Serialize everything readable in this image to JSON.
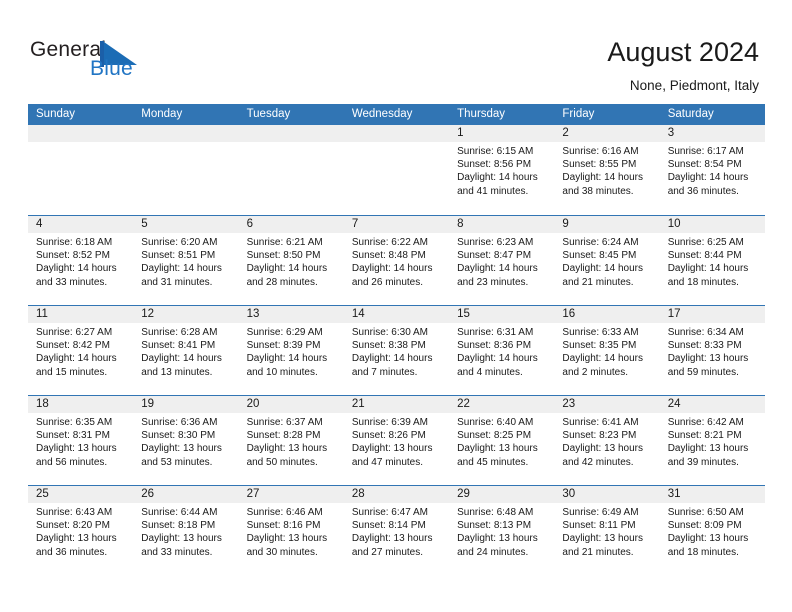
{
  "brand": {
    "name_part1": "General",
    "name_part2": "Blue",
    "logo_icon": "blue-flag-logo"
  },
  "header": {
    "title": "August 2024",
    "subtitle": "None, Piedmont, Italy"
  },
  "colors": {
    "header_blue": "#3175b4",
    "brand_blue": "#2175c4",
    "day_band_gray": "#efefef",
    "text": "#1a1a1a"
  },
  "weekdays": [
    "Sunday",
    "Monday",
    "Tuesday",
    "Wednesday",
    "Thursday",
    "Friday",
    "Saturday"
  ],
  "weeks": [
    [
      {
        "day": "",
        "empty": true
      },
      {
        "day": "",
        "empty": true
      },
      {
        "day": "",
        "empty": true
      },
      {
        "day": "",
        "empty": true
      },
      {
        "day": "1",
        "sunrise": "Sunrise: 6:15 AM",
        "sunset": "Sunset: 8:56 PM",
        "daylight": "Daylight: 14 hours and 41 minutes."
      },
      {
        "day": "2",
        "sunrise": "Sunrise: 6:16 AM",
        "sunset": "Sunset: 8:55 PM",
        "daylight": "Daylight: 14 hours and 38 minutes."
      },
      {
        "day": "3",
        "sunrise": "Sunrise: 6:17 AM",
        "sunset": "Sunset: 8:54 PM",
        "daylight": "Daylight: 14 hours and 36 minutes."
      }
    ],
    [
      {
        "day": "4",
        "sunrise": "Sunrise: 6:18 AM",
        "sunset": "Sunset: 8:52 PM",
        "daylight": "Daylight: 14 hours and 33 minutes."
      },
      {
        "day": "5",
        "sunrise": "Sunrise: 6:20 AM",
        "sunset": "Sunset: 8:51 PM",
        "daylight": "Daylight: 14 hours and 31 minutes."
      },
      {
        "day": "6",
        "sunrise": "Sunrise: 6:21 AM",
        "sunset": "Sunset: 8:50 PM",
        "daylight": "Daylight: 14 hours and 28 minutes."
      },
      {
        "day": "7",
        "sunrise": "Sunrise: 6:22 AM",
        "sunset": "Sunset: 8:48 PM",
        "daylight": "Daylight: 14 hours and 26 minutes."
      },
      {
        "day": "8",
        "sunrise": "Sunrise: 6:23 AM",
        "sunset": "Sunset: 8:47 PM",
        "daylight": "Daylight: 14 hours and 23 minutes."
      },
      {
        "day": "9",
        "sunrise": "Sunrise: 6:24 AM",
        "sunset": "Sunset: 8:45 PM",
        "daylight": "Daylight: 14 hours and 21 minutes."
      },
      {
        "day": "10",
        "sunrise": "Sunrise: 6:25 AM",
        "sunset": "Sunset: 8:44 PM",
        "daylight": "Daylight: 14 hours and 18 minutes."
      }
    ],
    [
      {
        "day": "11",
        "sunrise": "Sunrise: 6:27 AM",
        "sunset": "Sunset: 8:42 PM",
        "daylight": "Daylight: 14 hours and 15 minutes."
      },
      {
        "day": "12",
        "sunrise": "Sunrise: 6:28 AM",
        "sunset": "Sunset: 8:41 PM",
        "daylight": "Daylight: 14 hours and 13 minutes."
      },
      {
        "day": "13",
        "sunrise": "Sunrise: 6:29 AM",
        "sunset": "Sunset: 8:39 PM",
        "daylight": "Daylight: 14 hours and 10 minutes."
      },
      {
        "day": "14",
        "sunrise": "Sunrise: 6:30 AM",
        "sunset": "Sunset: 8:38 PM",
        "daylight": "Daylight: 14 hours and 7 minutes."
      },
      {
        "day": "15",
        "sunrise": "Sunrise: 6:31 AM",
        "sunset": "Sunset: 8:36 PM",
        "daylight": "Daylight: 14 hours and 4 minutes."
      },
      {
        "day": "16",
        "sunrise": "Sunrise: 6:33 AM",
        "sunset": "Sunset: 8:35 PM",
        "daylight": "Daylight: 14 hours and 2 minutes."
      },
      {
        "day": "17",
        "sunrise": "Sunrise: 6:34 AM",
        "sunset": "Sunset: 8:33 PM",
        "daylight": "Daylight: 13 hours and 59 minutes."
      }
    ],
    [
      {
        "day": "18",
        "sunrise": "Sunrise: 6:35 AM",
        "sunset": "Sunset: 8:31 PM",
        "daylight": "Daylight: 13 hours and 56 minutes."
      },
      {
        "day": "19",
        "sunrise": "Sunrise: 6:36 AM",
        "sunset": "Sunset: 8:30 PM",
        "daylight": "Daylight: 13 hours and 53 minutes."
      },
      {
        "day": "20",
        "sunrise": "Sunrise: 6:37 AM",
        "sunset": "Sunset: 8:28 PM",
        "daylight": "Daylight: 13 hours and 50 minutes."
      },
      {
        "day": "21",
        "sunrise": "Sunrise: 6:39 AM",
        "sunset": "Sunset: 8:26 PM",
        "daylight": "Daylight: 13 hours and 47 minutes."
      },
      {
        "day": "22",
        "sunrise": "Sunrise: 6:40 AM",
        "sunset": "Sunset: 8:25 PM",
        "daylight": "Daylight: 13 hours and 45 minutes."
      },
      {
        "day": "23",
        "sunrise": "Sunrise: 6:41 AM",
        "sunset": "Sunset: 8:23 PM",
        "daylight": "Daylight: 13 hours and 42 minutes."
      },
      {
        "day": "24",
        "sunrise": "Sunrise: 6:42 AM",
        "sunset": "Sunset: 8:21 PM",
        "daylight": "Daylight: 13 hours and 39 minutes."
      }
    ],
    [
      {
        "day": "25",
        "sunrise": "Sunrise: 6:43 AM",
        "sunset": "Sunset: 8:20 PM",
        "daylight": "Daylight: 13 hours and 36 minutes."
      },
      {
        "day": "26",
        "sunrise": "Sunrise: 6:44 AM",
        "sunset": "Sunset: 8:18 PM",
        "daylight": "Daylight: 13 hours and 33 minutes."
      },
      {
        "day": "27",
        "sunrise": "Sunrise: 6:46 AM",
        "sunset": "Sunset: 8:16 PM",
        "daylight": "Daylight: 13 hours and 30 minutes."
      },
      {
        "day": "28",
        "sunrise": "Sunrise: 6:47 AM",
        "sunset": "Sunset: 8:14 PM",
        "daylight": "Daylight: 13 hours and 27 minutes."
      },
      {
        "day": "29",
        "sunrise": "Sunrise: 6:48 AM",
        "sunset": "Sunset: 8:13 PM",
        "daylight": "Daylight: 13 hours and 24 minutes."
      },
      {
        "day": "30",
        "sunrise": "Sunrise: 6:49 AM",
        "sunset": "Sunset: 8:11 PM",
        "daylight": "Daylight: 13 hours and 21 minutes."
      },
      {
        "day": "31",
        "sunrise": "Sunrise: 6:50 AM",
        "sunset": "Sunset: 8:09 PM",
        "daylight": "Daylight: 13 hours and 18 minutes."
      }
    ]
  ]
}
